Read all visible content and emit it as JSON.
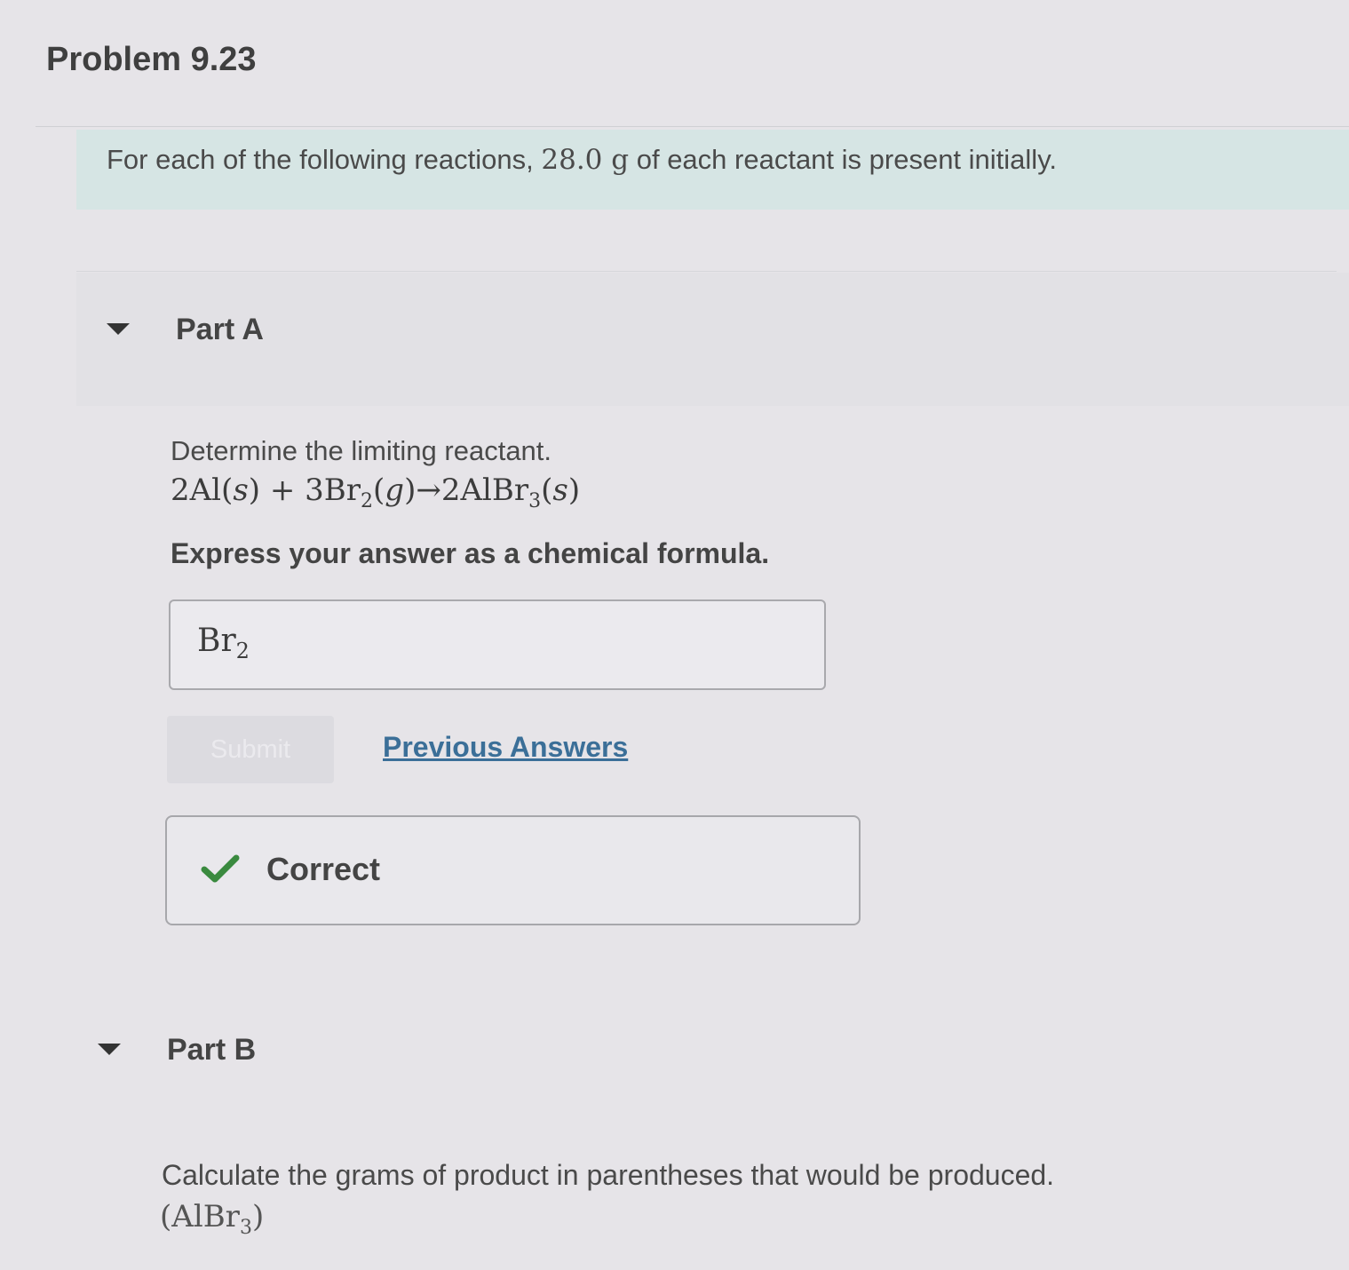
{
  "problem": {
    "title": "Problem 9.23",
    "intro_before": "For each of the following reactions, ",
    "intro_mass": "28.0 g",
    "intro_after": " of each reactant is present initially."
  },
  "part_a": {
    "label": "Part A",
    "instruction": "Determine the limiting reactant.",
    "equation": {
      "t1": "2Al(",
      "t2": "s",
      "t3": ") + 3Br",
      "t4": "2",
      "t5": "(",
      "t6": "g",
      "t7": ")→2AlBr",
      "t8": "3",
      "t9": "(",
      "t10": "s",
      "t11": ")"
    },
    "express": "Express your answer as a chemical formula.",
    "answer_main": "Br",
    "answer_sub": "2",
    "submit_label": "Submit",
    "previous_answers_label": "Previous Answers",
    "feedback_icon": "checkmark-icon",
    "feedback_label": "Correct"
  },
  "part_b": {
    "label": "Part B",
    "instruction": "Calculate the grams of product in parentheses that would be produced.",
    "product": {
      "open": "(AlBr",
      "sub": "3",
      "close": ")"
    }
  },
  "colors": {
    "banner": "#d6e5e4",
    "link": "#3b6f98",
    "check": "#3a8a3f"
  }
}
